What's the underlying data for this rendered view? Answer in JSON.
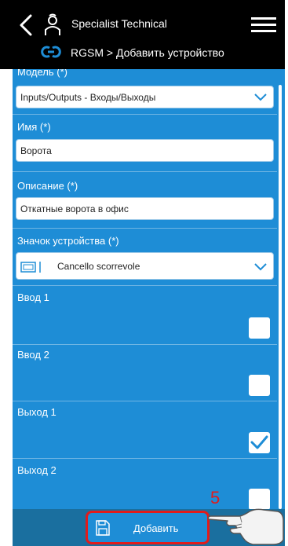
{
  "header": {
    "title": "Specialist Technical",
    "breadcrumb": "RGSM > Добавить устройство"
  },
  "form": {
    "model": {
      "label": "Модель (*)",
      "value": "Inputs/Outputs - Входы/Выходы"
    },
    "name": {
      "label": "Имя (*)",
      "value": "Ворота"
    },
    "description": {
      "label": "Описание (*)",
      "value": "Откатные ворота в офис"
    },
    "device_icon": {
      "label": "Значок устройства (*)",
      "value": "Cancello scorrevole"
    },
    "inputs": [
      {
        "label": "Ввод 1",
        "checked": false
      },
      {
        "label": "Ввод 2",
        "checked": false
      }
    ],
    "outputs": [
      {
        "label": "Выход 1",
        "checked": true
      },
      {
        "label": "Выход 2",
        "checked": false
      }
    ]
  },
  "footer": {
    "add_label": "Добавить",
    "step_annotation": "5"
  },
  "colors": {
    "header_bg": "#000000",
    "content_bg": "#1e8dd6",
    "bottom_bar_bg": "#1a6f9f",
    "highlight": "#e11b1b",
    "checkmark": "#1e8dd6"
  },
  "icons": [
    "back-icon",
    "user-icon",
    "menu-icon",
    "rgsm-logo-icon",
    "chevron-down-icon",
    "device-icon",
    "checkmark-icon",
    "save-icon",
    "pointing-hand-icon"
  ]
}
